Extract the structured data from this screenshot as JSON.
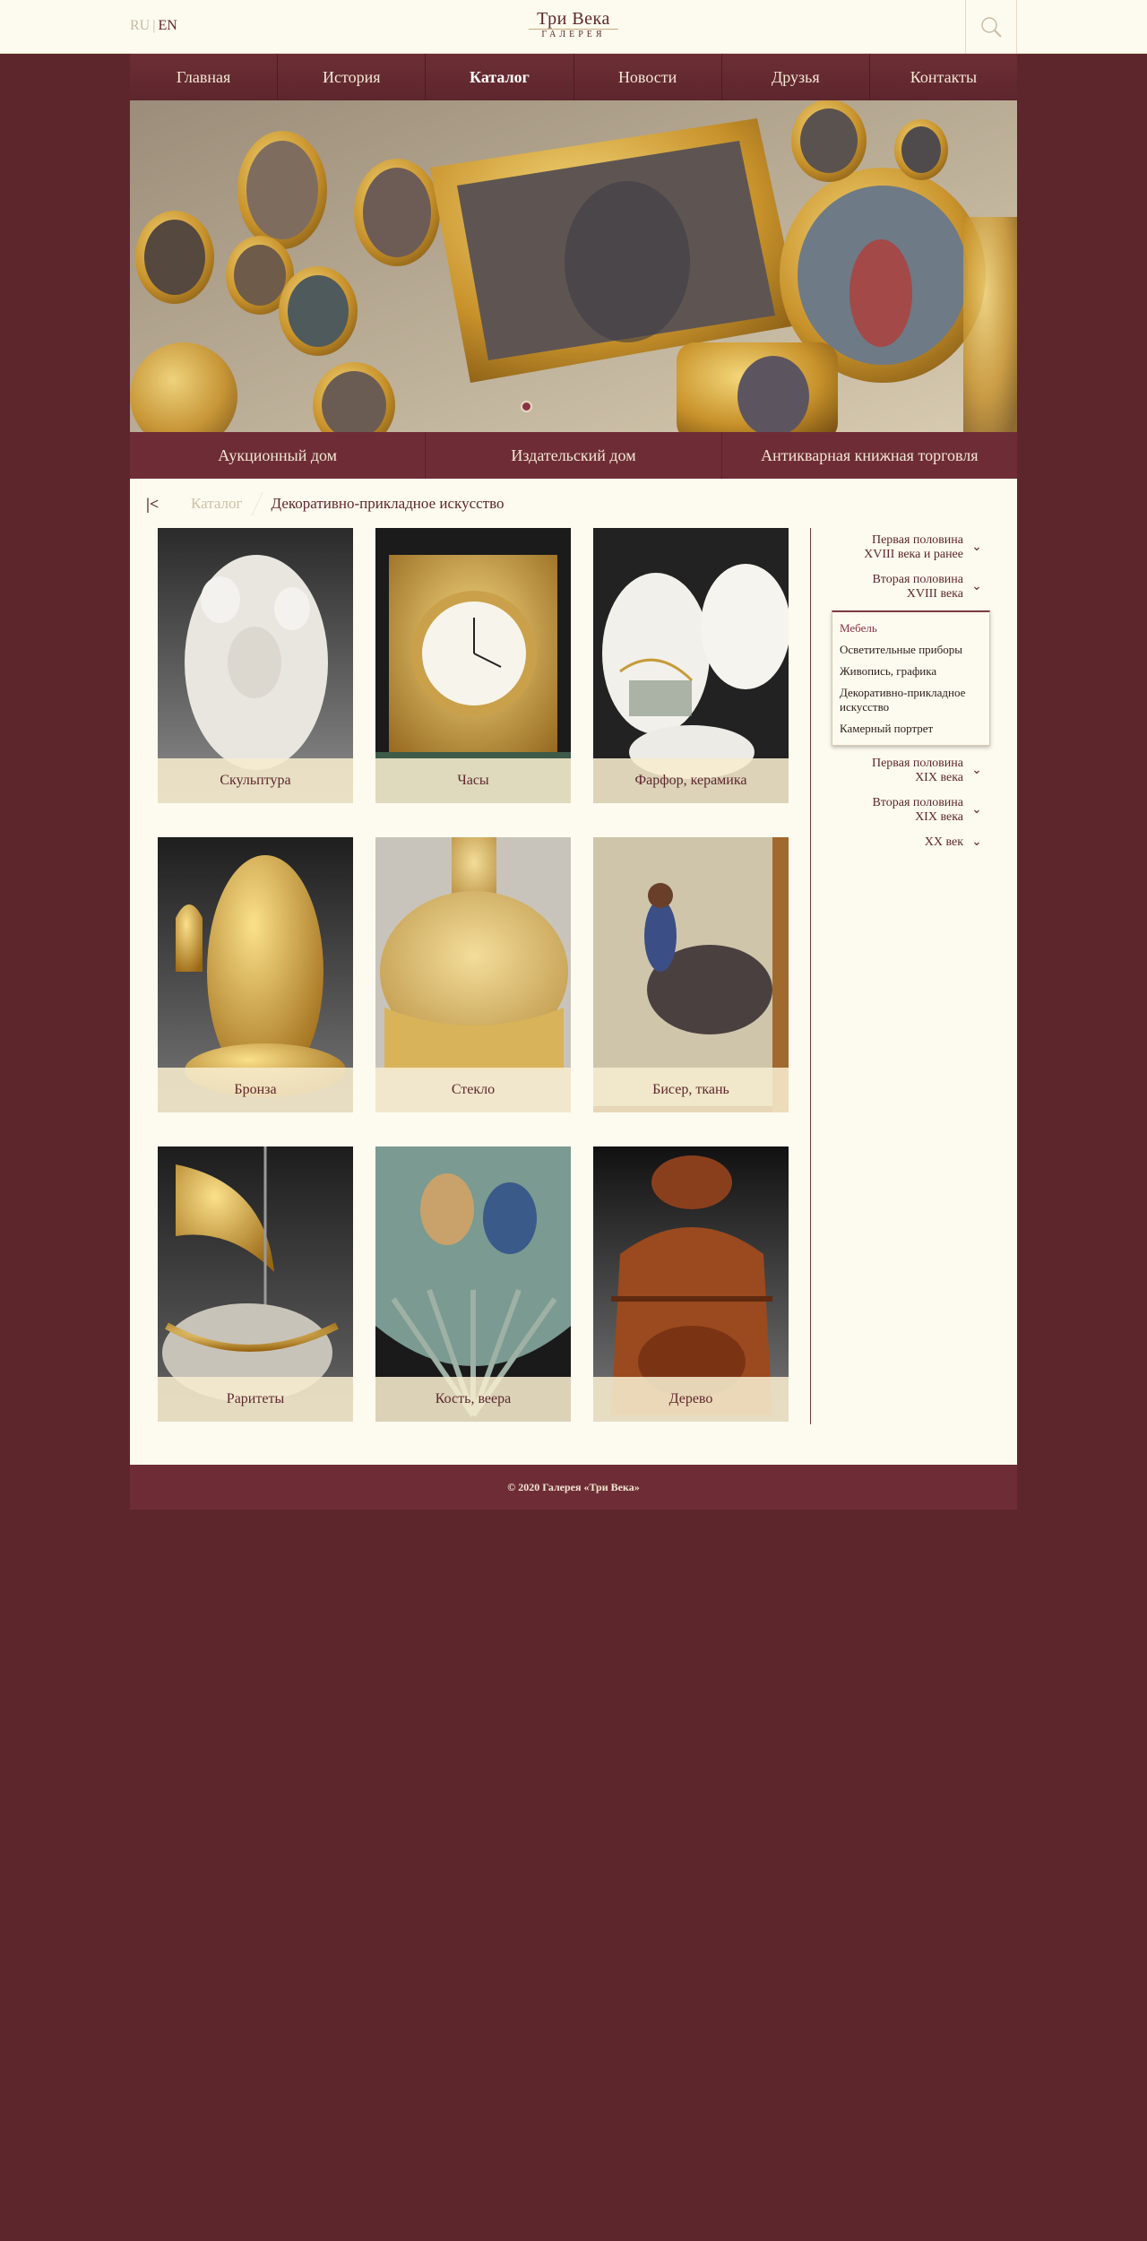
{
  "header": {
    "lang_ru": "RU",
    "lang_sep": "|",
    "lang_en": "EN",
    "logo_line1": "Три Века",
    "logo_line2": "ГАЛЕРЕЯ",
    "search_icon": "search-icon"
  },
  "nav": {
    "items": [
      "Главная",
      "История",
      "Каталог",
      "Новости",
      "Друзья",
      "Контакты"
    ],
    "active": "Каталог"
  },
  "hero": {
    "slides_count": 1,
    "active_slide": 1
  },
  "subnav": {
    "items": [
      "Аукционный дом",
      "Издательский дом",
      "Антикварная книжная торговля"
    ]
  },
  "breadcrumb": {
    "back_icon": "back-to-start-icon",
    "catalog": "Каталог",
    "current": "Декоративно-прикладное искусство"
  },
  "categories": [
    {
      "label": "Скульптура"
    },
    {
      "label": "Часы"
    },
    {
      "label": "Фарфор, керамика"
    },
    {
      "label": "Бронза"
    },
    {
      "label": "Стекло"
    },
    {
      "label": "Бисер, ткань"
    },
    {
      "label": "Раритеты"
    },
    {
      "label": "Кость, веера"
    },
    {
      "label": "Дерево"
    }
  ],
  "sidebar": {
    "period1_line1": "Первая половина",
    "period1_line2": "XVIII века и ранее",
    "period2_line1": "Вторая половина",
    "period2_line2": "XVIII века",
    "sub_items": [
      "Мебель",
      "Осветительные приборы",
      "Живопись, графика",
      "Декоративно-прикладное искусство",
      "Камерный портрет"
    ],
    "period3_line1": "Первая половина",
    "period3_line2": "XIX века",
    "period4_line1": "Вторая половина",
    "period4_line2": "XIX века",
    "period5": "XX век",
    "chevron_icon": "chevron-down-icon"
  },
  "footer": {
    "copyright": "© 2020 Галерея «Три Века»"
  },
  "colors": {
    "page_bg": "#5d262d",
    "content_bg": "#fdfbef",
    "accent": "#8a3346",
    "caption_bg": "#f6ecce"
  }
}
